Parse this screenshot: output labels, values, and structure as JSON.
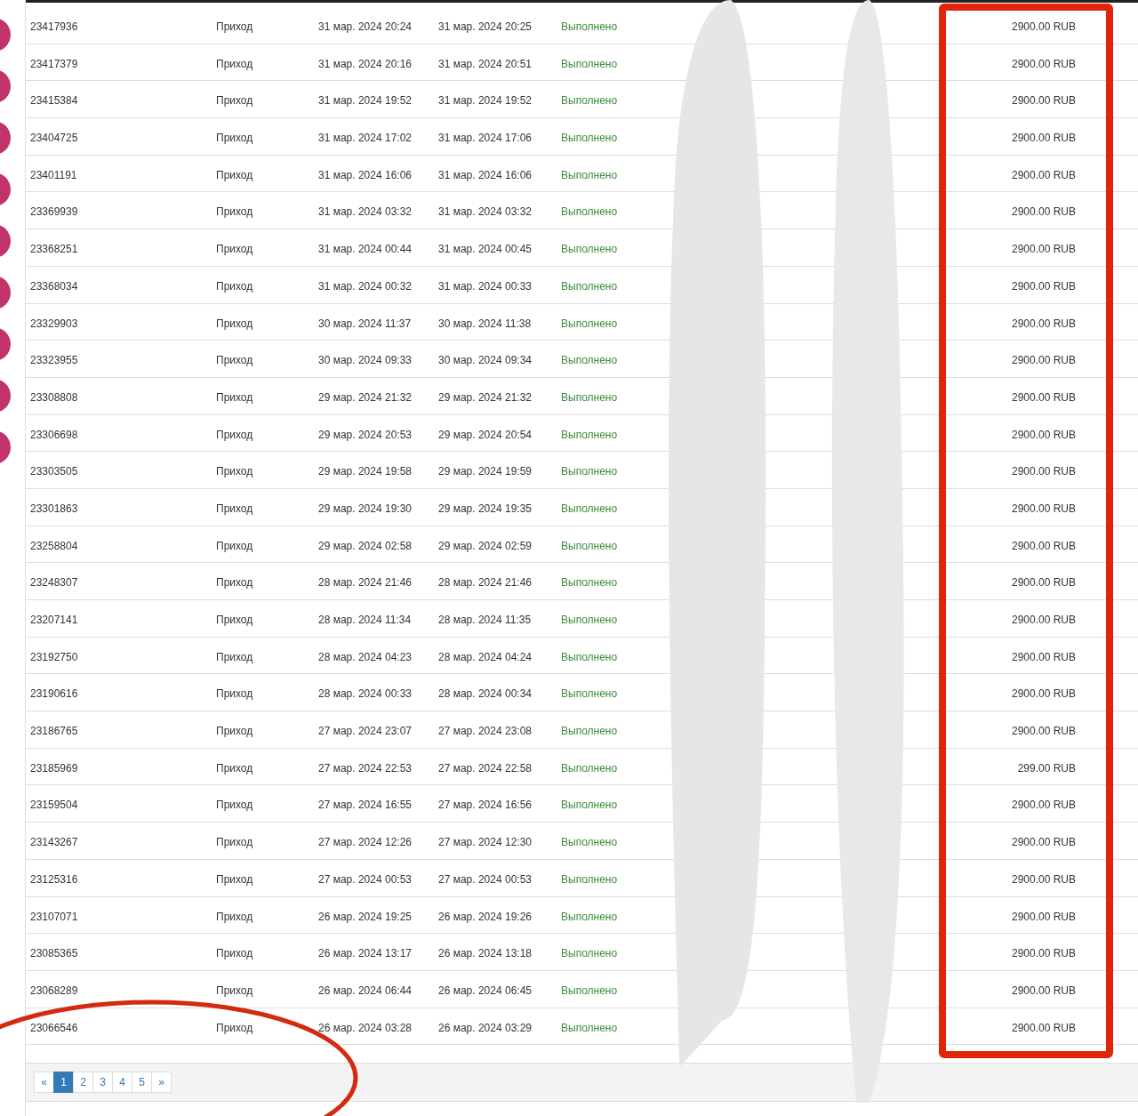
{
  "table": {
    "rows": [
      {
        "id": "23417936",
        "type": "Приход",
        "created": "31 мар. 2024 20:24",
        "completed": "31 мар. 2024 20:25",
        "status": "Выполнено",
        "amount": "2900.00 RUB"
      },
      {
        "id": "23417379",
        "type": "Приход",
        "created": "31 мар. 2024 20:16",
        "completed": "31 мар. 2024 20:51",
        "status": "Выполнено",
        "amount": "2900.00 RUB"
      },
      {
        "id": "23415384",
        "type": "Приход",
        "created": "31 мар. 2024 19:52",
        "completed": "31 мар. 2024 19:52",
        "status": "Выполнено",
        "amount": "2900.00 RUB"
      },
      {
        "id": "23404725",
        "type": "Приход",
        "created": "31 мар. 2024 17:02",
        "completed": "31 мар. 2024 17:06",
        "status": "Выполнено",
        "amount": "2900.00 RUB"
      },
      {
        "id": "23401191",
        "type": "Приход",
        "created": "31 мар. 2024 16:06",
        "completed": "31 мар. 2024 16:06",
        "status": "Выполнено",
        "amount": "2900.00 RUB"
      },
      {
        "id": "23369939",
        "type": "Приход",
        "created": "31 мар. 2024 03:32",
        "completed": "31 мар. 2024 03:32",
        "status": "Выполнено",
        "amount": "2900.00 RUB"
      },
      {
        "id": "23368251",
        "type": "Приход",
        "created": "31 мар. 2024 00:44",
        "completed": "31 мар. 2024 00:45",
        "status": "Выполнено",
        "amount": "2900.00 RUB"
      },
      {
        "id": "23368034",
        "type": "Приход",
        "created": "31 мар. 2024 00:32",
        "completed": "31 мар. 2024 00:33",
        "status": "Выполнено",
        "amount": "2900.00 RUB"
      },
      {
        "id": "23329903",
        "type": "Приход",
        "created": "30 мар. 2024 11:37",
        "completed": "30 мар. 2024 11:38",
        "status": "Выполнено",
        "amount": "2900.00 RUB"
      },
      {
        "id": "23323955",
        "type": "Приход",
        "created": "30 мар. 2024 09:33",
        "completed": "30 мар. 2024 09:34",
        "status": "Выполнено",
        "amount": "2900.00 RUB"
      },
      {
        "id": "23308808",
        "type": "Приход",
        "created": "29 мар. 2024 21:32",
        "completed": "29 мар. 2024 21:32",
        "status": "Выполнено",
        "amount": "2900.00 RUB"
      },
      {
        "id": "23306698",
        "type": "Приход",
        "created": "29 мар. 2024 20:53",
        "completed": "29 мар. 2024 20:54",
        "status": "Выполнено",
        "amount": "2900.00 RUB"
      },
      {
        "id": "23303505",
        "type": "Приход",
        "created": "29 мар. 2024 19:58",
        "completed": "29 мар. 2024 19:59",
        "status": "Выполнено",
        "amount": "2900.00 RUB"
      },
      {
        "id": "23301863",
        "type": "Приход",
        "created": "29 мар. 2024 19:30",
        "completed": "29 мар. 2024 19:35",
        "status": "Выполнено",
        "amount": "2900.00 RUB"
      },
      {
        "id": "23258804",
        "type": "Приход",
        "created": "29 мар. 2024 02:58",
        "completed": "29 мар. 2024 02:59",
        "status": "Выполнено",
        "amount": "2900.00 RUB"
      },
      {
        "id": "23248307",
        "type": "Приход",
        "created": "28 мар. 2024 21:46",
        "completed": "28 мар. 2024 21:46",
        "status": "Выполнено",
        "amount": "2900.00 RUB"
      },
      {
        "id": "23207141",
        "type": "Приход",
        "created": "28 мар. 2024 11:34",
        "completed": "28 мар. 2024 11:35",
        "status": "Выполнено",
        "amount": "2900.00 RUB"
      },
      {
        "id": "23192750",
        "type": "Приход",
        "created": "28 мар. 2024 04:23",
        "completed": "28 мар. 2024 04:24",
        "status": "Выполнено",
        "amount": "2900.00 RUB"
      },
      {
        "id": "23190616",
        "type": "Приход",
        "created": "28 мар. 2024 00:33",
        "completed": "28 мар. 2024 00:34",
        "status": "Выполнено",
        "amount": "2900.00 RUB"
      },
      {
        "id": "23186765",
        "type": "Приход",
        "created": "27 мар. 2024 23:07",
        "completed": "27 мар. 2024 23:08",
        "status": "Выполнено",
        "amount": "2900.00 RUB"
      },
      {
        "id": "23185969",
        "type": "Приход",
        "created": "27 мар. 2024 22:53",
        "completed": "27 мар. 2024 22:58",
        "status": "Выполнено",
        "amount": "299.00 RUB"
      },
      {
        "id": "23159504",
        "type": "Приход",
        "created": "27 мар. 2024 16:55",
        "completed": "27 мар. 2024 16:56",
        "status": "Выполнено",
        "amount": "2900.00 RUB"
      },
      {
        "id": "23143267",
        "type": "Приход",
        "created": "27 мар. 2024 12:26",
        "completed": "27 мар. 2024 12:30",
        "status": "Выполнено",
        "amount": "2900.00 RUB"
      },
      {
        "id": "23125316",
        "type": "Приход",
        "created": "27 мар. 2024 00:53",
        "completed": "27 мар. 2024 00:53",
        "status": "Выполнено",
        "amount": "2900.00 RUB"
      },
      {
        "id": "23107071",
        "type": "Приход",
        "created": "26 мар. 2024 19:25",
        "completed": "26 мар. 2024 19:26",
        "status": "Выполнено",
        "amount": "2900.00 RUB"
      },
      {
        "id": "23085365",
        "type": "Приход",
        "created": "26 мар. 2024 13:17",
        "completed": "26 мар. 2024 13:18",
        "status": "Выполнено",
        "amount": "2900.00 RUB"
      },
      {
        "id": "23068289",
        "type": "Приход",
        "created": "26 мар. 2024 06:44",
        "completed": "26 мар. 2024 06:45",
        "status": "Выполнено",
        "amount": "2900.00 RUB"
      },
      {
        "id": "23066546",
        "type": "Приход",
        "created": "26 мар. 2024 03:28",
        "completed": "26 мар. 2024 03:29",
        "status": "Выполнено",
        "amount": "2900.00 RUB"
      }
    ]
  },
  "pagination": [
    {
      "label": "«",
      "selected": false
    },
    {
      "label": "1",
      "selected": true
    },
    {
      "label": "2",
      "selected": false
    },
    {
      "label": "3",
      "selected": false
    },
    {
      "label": "4",
      "selected": false
    },
    {
      "label": "5",
      "selected": false
    },
    {
      "label": "»",
      "selected": false
    }
  ]
}
